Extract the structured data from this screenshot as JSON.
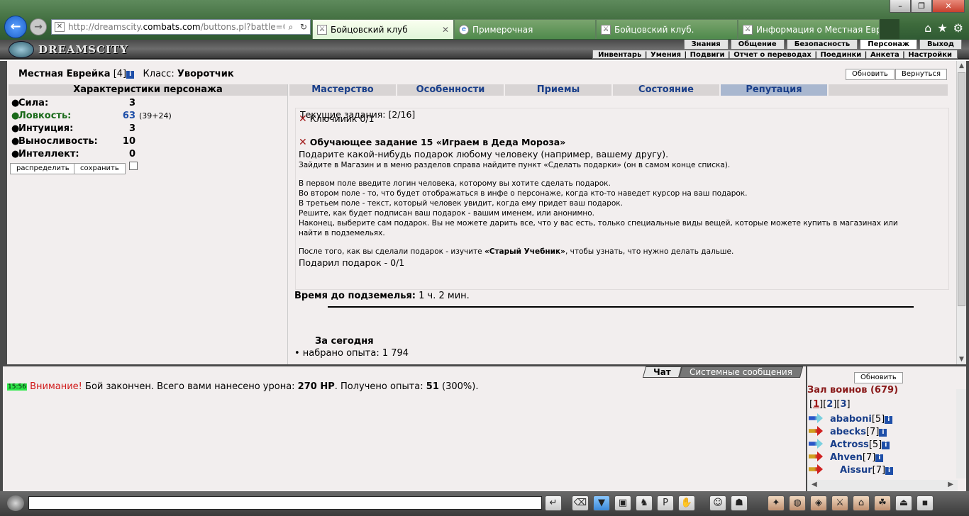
{
  "browser": {
    "url_prefix": "http://dreamscity.",
    "url_domain": "combats.com",
    "url_suffix": "/buttons.pl?battle=0.4",
    "tabs": [
      {
        "title": "Бойцовский клуб",
        "active": true
      },
      {
        "title": "Примерочная"
      },
      {
        "title": "Бойцовский клуб."
      },
      {
        "title": "Информация о Местная Евре..."
      }
    ]
  },
  "game": {
    "logo": "DREAMSCITY",
    "menu_top": [
      "Знания",
      "Общение",
      "Безопасность",
      "Персонаж",
      "Выход"
    ],
    "menu_sub": [
      "Инвентарь",
      "Умения",
      "Подвиги",
      "Отчет о переводах",
      "Поединки",
      "Анкета",
      "Настройки"
    ]
  },
  "character": {
    "name": "Местная Еврейка",
    "level": "[4]",
    "class_label": "Класс:",
    "class_value": "Уворотчик",
    "refresh_btn": "Обновить",
    "return_btn": "Вернуться"
  },
  "stats": {
    "title": "Характеристики персонажа",
    "items": [
      {
        "label": "Сила:",
        "value": "3"
      },
      {
        "label": "Ловкость:",
        "value": "63",
        "mod": "(39+24)"
      },
      {
        "label": "Интуиция:",
        "value": "3"
      },
      {
        "label": "Выносливость:",
        "value": "10"
      },
      {
        "label": "Интеллект:",
        "value": "0"
      }
    ],
    "distribute_btn": "распределить",
    "save_btn": "сохранить"
  },
  "tabs": [
    "Мастерство",
    "Особенности",
    "Приемы",
    "Состояние",
    "Репутация"
  ],
  "quests": {
    "header": "Текущие задания: [2/16]",
    "q1": "Ключииик 0/1",
    "q2_title": "Обучающее задание 15 «Играем в Деда Мороза»",
    "q2_lead": "Подарите какой-нибудь подарок любому человеку (например, вашему другу).",
    "q2_p1": "Зайдите в Магазин и в меню разделов справа найдите пункт «Сделать подарки» (он в самом конце списка).",
    "q2_p2": "В первом поле введите логин человека, которому вы хотите сделать подарок.",
    "q2_p3": "Во втором поле - то, что будет отображаться в инфе о персонаже, когда кто-то наведет курсор на ваш подарок.",
    "q2_p4": "В третьем поле - текст, который человек увидит, когда ему придет ваш подарок.",
    "q2_p5": "Решите, как будет подписан ваш подарок - вашим именем, или анонимно.",
    "q2_p6": "Наконец, выберите сам подарок. Вы не можете дарить все, что у вас есть, только специальные виды вещей, которые можете купить в магазинах или",
    "q2_p7": "найти в подземельях.",
    "q2_p8a": "После того, как вы сделали подарок - изучите ",
    "q2_p8b": "«Старый Учебник»",
    "q2_p8c": ", чтобы узнать, что нужно делать дальше.",
    "q2_progress": "Подарил подарок - 0/1"
  },
  "dungeon": {
    "label": "Время до подземелья:",
    "value": "1 ч. 2 мин."
  },
  "today": {
    "title": "За сегодня",
    "exp_line": "• набрано опыта: 1 794"
  },
  "chat": {
    "tab_chat": "Чат",
    "tab_system": "Системные сообщения",
    "time": "15:56",
    "warn": "Внимание!",
    "msg1": " Бой закончен. Всего вами нанесено урона: ",
    "damage": "270 HP",
    "msg2": ". Получено опыта: ",
    "exp": "51",
    "msg3": " (300%)."
  },
  "room": {
    "refresh_btn": "Обновить",
    "title": "Зал воинов (679)",
    "pages": [
      "1",
      "2",
      "3"
    ],
    "players": [
      {
        "name": "ababoni",
        "level": "[5]",
        "icon": "blue"
      },
      {
        "name": "abecks",
        "level": "[7]",
        "icon": "red"
      },
      {
        "name": "Actross",
        "level": "[5]",
        "icon": "blue"
      },
      {
        "name": "Ahven",
        "level": "[7]",
        "icon": "red"
      },
      {
        "name": "Aissur",
        "level": "[7]",
        "icon": "red"
      }
    ]
  }
}
